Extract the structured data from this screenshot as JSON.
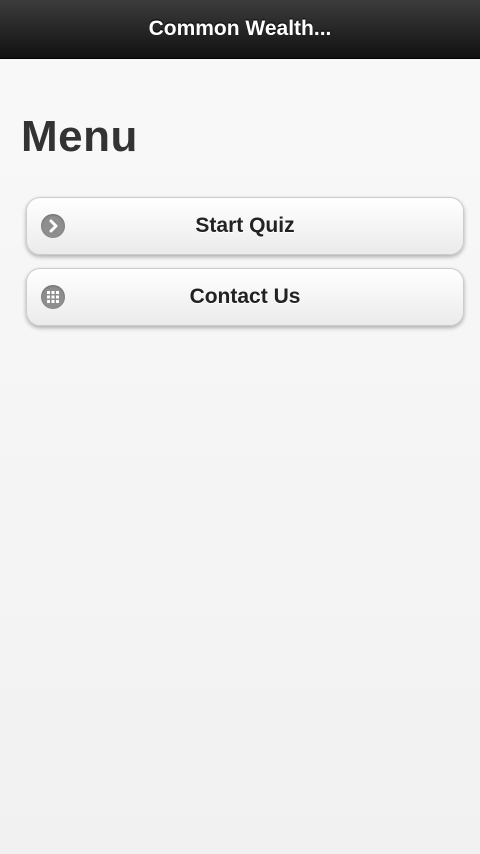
{
  "header": {
    "title": "Common Wealth..."
  },
  "page": {
    "heading": "Menu"
  },
  "menu": {
    "items": [
      {
        "label": "Start Quiz",
        "icon": "chevron-right-icon"
      },
      {
        "label": "Contact Us",
        "icon": "grid-icon"
      }
    ]
  },
  "colors": {
    "header_bg": "#1a1a1a",
    "page_bg": "#f5f5f5",
    "icon_bg": "#8e8e8e"
  }
}
